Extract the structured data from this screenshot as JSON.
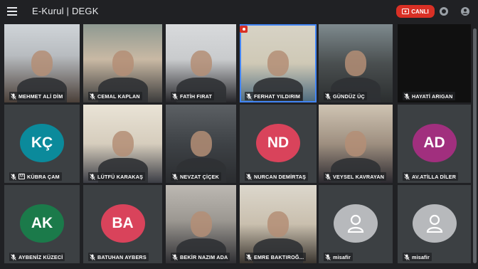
{
  "app": {
    "title": "E-Kurul | DEGK",
    "live_label": "CANLI"
  },
  "tiles": [
    {
      "name": "MEHMET ALİ DİM",
      "type": "video"
    },
    {
      "name": "CEMAL KAPLAN",
      "type": "video"
    },
    {
      "name": "FATİH FIRAT",
      "type": "video"
    },
    {
      "name": "FERHAT YILDIRIM",
      "type": "video",
      "active": true
    },
    {
      "name": "GÜNDÜZ ÜÇ",
      "type": "video"
    },
    {
      "name": "HAYATİ ARIGAN",
      "type": "video-off"
    },
    {
      "name": "KÜBRA ÇAM",
      "type": "avatar",
      "initials": "KÇ",
      "color": "#0b8a9b",
      "badge": "M"
    },
    {
      "name": "LÜTFÜ KARAKAŞ",
      "type": "video"
    },
    {
      "name": "NEVZAT ÇİÇEK",
      "type": "video"
    },
    {
      "name": "NURCAN DEMİRTAŞ",
      "type": "avatar",
      "initials": "ND",
      "color": "#d9435b"
    },
    {
      "name": "VEYSEL KAVRAYAN",
      "type": "video"
    },
    {
      "name": "AV.ATİLLA DİLER",
      "type": "avatar",
      "initials": "AD",
      "color": "#a12f7e"
    },
    {
      "name": "AYBENİZ KÜZECİ",
      "type": "avatar",
      "initials": "AK",
      "color": "#1b7a4a"
    },
    {
      "name": "BATUHAN AYBERS",
      "type": "avatar",
      "initials": "BA",
      "color": "#d9435b"
    },
    {
      "name": "BEKİR NAZIM ADA",
      "type": "video"
    },
    {
      "name": "EMRE BAKTIROĞ...",
      "type": "video"
    },
    {
      "name": "misafir",
      "type": "guest"
    },
    {
      "name": "misafir",
      "type": "guest"
    }
  ],
  "colors": {
    "live": "#d93025",
    "active_border": "#4285f4",
    "background": "#202124"
  },
  "icons": {
    "menu": "hamburger-icon",
    "live": "broadcast-icon",
    "record": "record-icon",
    "account": "account-circle-icon",
    "mic": "mic-off-icon"
  }
}
